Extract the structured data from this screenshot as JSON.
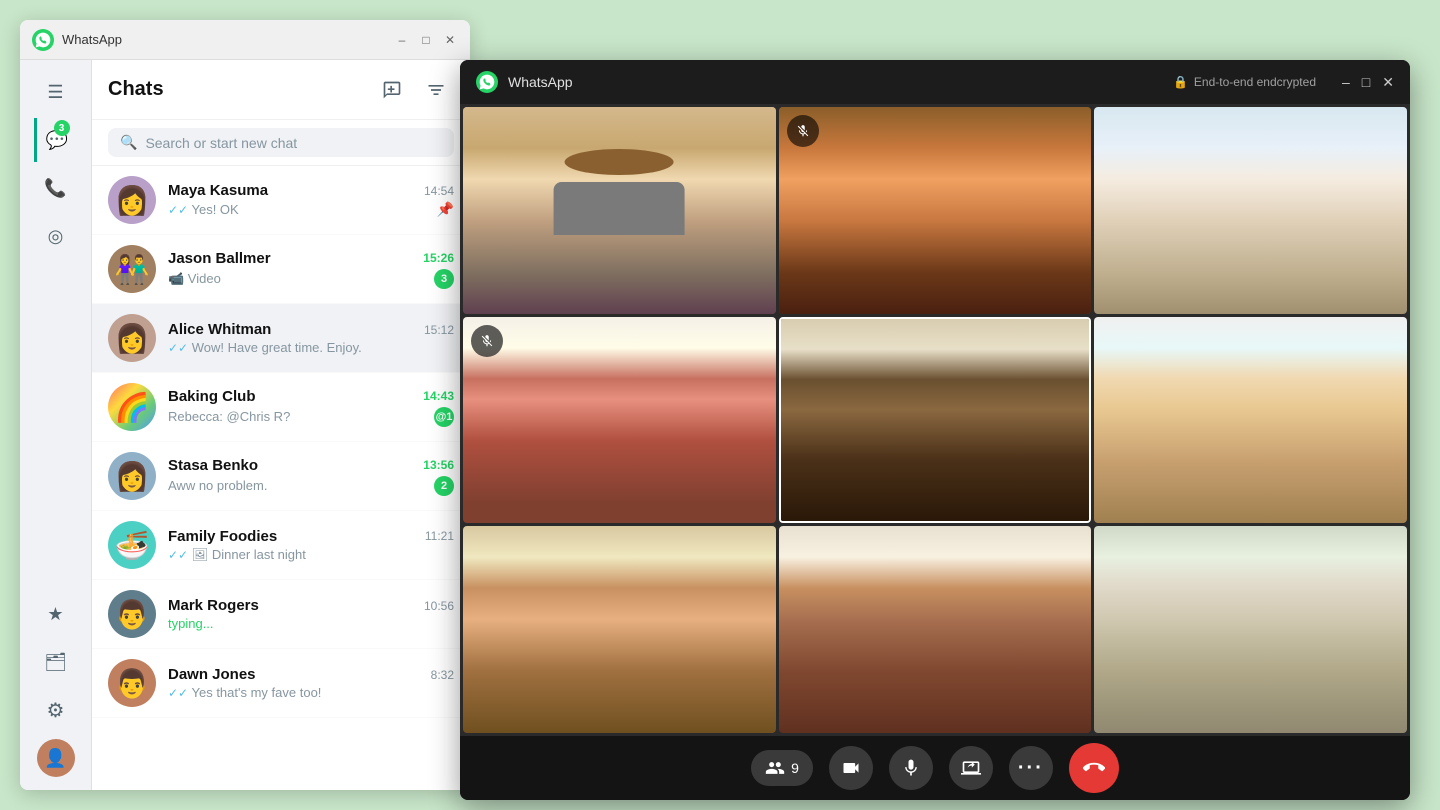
{
  "app": {
    "title": "WhatsApp",
    "encrypted_label": "End-to-end endcrypted"
  },
  "main_window": {
    "title": "WhatsApp",
    "minimize": "–",
    "maximize": "□",
    "close": "✕"
  },
  "sidebar": {
    "notification_badge": "3",
    "icons": [
      {
        "name": "menu",
        "symbol": "☰",
        "active": false
      },
      {
        "name": "chats",
        "symbol": "💬",
        "active": true,
        "badge": "3"
      },
      {
        "name": "calls",
        "symbol": "📞",
        "active": false
      },
      {
        "name": "status",
        "symbol": "◎",
        "active": false
      },
      {
        "name": "starred",
        "symbol": "★",
        "active": false
      },
      {
        "name": "archived",
        "symbol": "🗂",
        "active": false
      },
      {
        "name": "settings",
        "symbol": "⚙",
        "active": false
      }
    ]
  },
  "chats": {
    "title": "Chats",
    "new_chat_tooltip": "New chat",
    "filter_tooltip": "Filter",
    "search_placeholder": "Search or start new chat",
    "items": [
      {
        "id": 1,
        "name": "Maya Kasuma",
        "preview": "Yes! OK",
        "time": "14:54",
        "time_type": "normal",
        "pin": true,
        "unread": 0,
        "check": "double",
        "avatar_color": "#b0a0b8",
        "avatar_text": "👩"
      },
      {
        "id": 2,
        "name": "Jason Ballmer",
        "preview": "📹 Video",
        "time": "15:26",
        "time_type": "unread",
        "unread": 3,
        "check": "none",
        "avatar_color": "#a08060",
        "avatar_text": "👫"
      },
      {
        "id": 3,
        "name": "Alice Whitman",
        "preview": "Wow! Have great time. Enjoy.",
        "time": "15:12",
        "time_type": "normal",
        "unread": 0,
        "check": "double",
        "avatar_color": "#c0a090",
        "avatar_text": "👩",
        "active": true
      },
      {
        "id": 4,
        "name": "Baking Club",
        "preview": "Rebecca: @Chris R?",
        "time": "14:43",
        "time_type": "unread",
        "unread": 1,
        "mention": true,
        "check": "none",
        "avatar_color": "rainbow",
        "avatar_text": "🌈"
      },
      {
        "id": 5,
        "name": "Stasa Benko",
        "preview": "Aww no problem.",
        "time": "13:56",
        "time_type": "unread",
        "unread": 2,
        "check": "none",
        "avatar_color": "#90b0c0",
        "avatar_text": "👩"
      },
      {
        "id": 6,
        "name": "Family Foodies",
        "preview": "Dinner last night",
        "time": "11:21",
        "time_type": "normal",
        "unread": 0,
        "check": "double",
        "avatar_color": "#4dd0c4",
        "avatar_text": "🍜"
      },
      {
        "id": 7,
        "name": "Mark Rogers",
        "preview": "typing...",
        "time": "10:56",
        "time_type": "normal",
        "unread": 0,
        "typing": true,
        "avatar_color": "#607d8b",
        "avatar_text": "👨"
      },
      {
        "id": 8,
        "name": "Dawn Jones",
        "preview": "Yes that's my fave too!",
        "time": "8:32",
        "time_type": "normal",
        "unread": 0,
        "check": "double",
        "avatar_color": "#c08060",
        "avatar_text": "👨"
      }
    ]
  },
  "video_call": {
    "participants_count": "9",
    "icons": {
      "participants": "👥",
      "video": "📹",
      "mic": "🎤",
      "screen": "📤",
      "more": "•••",
      "end_call": "📞"
    },
    "cells": [
      {
        "id": 1,
        "muted": false,
        "highlighted": false,
        "bg_class": "p1-bg"
      },
      {
        "id": 2,
        "muted": true,
        "highlighted": false,
        "bg_class": "p2-bg"
      },
      {
        "id": 3,
        "muted": false,
        "highlighted": false,
        "bg_class": "p3-bg"
      },
      {
        "id": 4,
        "muted": true,
        "highlighted": false,
        "bg_class": "p4-bg"
      },
      {
        "id": 5,
        "muted": false,
        "highlighted": true,
        "bg_class": "p5-bg"
      },
      {
        "id": 6,
        "muted": false,
        "highlighted": false,
        "bg_class": "p6-bg"
      },
      {
        "id": 7,
        "muted": false,
        "highlighted": false,
        "bg_class": "p7-bg"
      },
      {
        "id": 8,
        "muted": false,
        "highlighted": false,
        "bg_class": "p8-bg"
      },
      {
        "id": 9,
        "muted": false,
        "highlighted": false,
        "bg_class": "p9-bg"
      }
    ]
  }
}
